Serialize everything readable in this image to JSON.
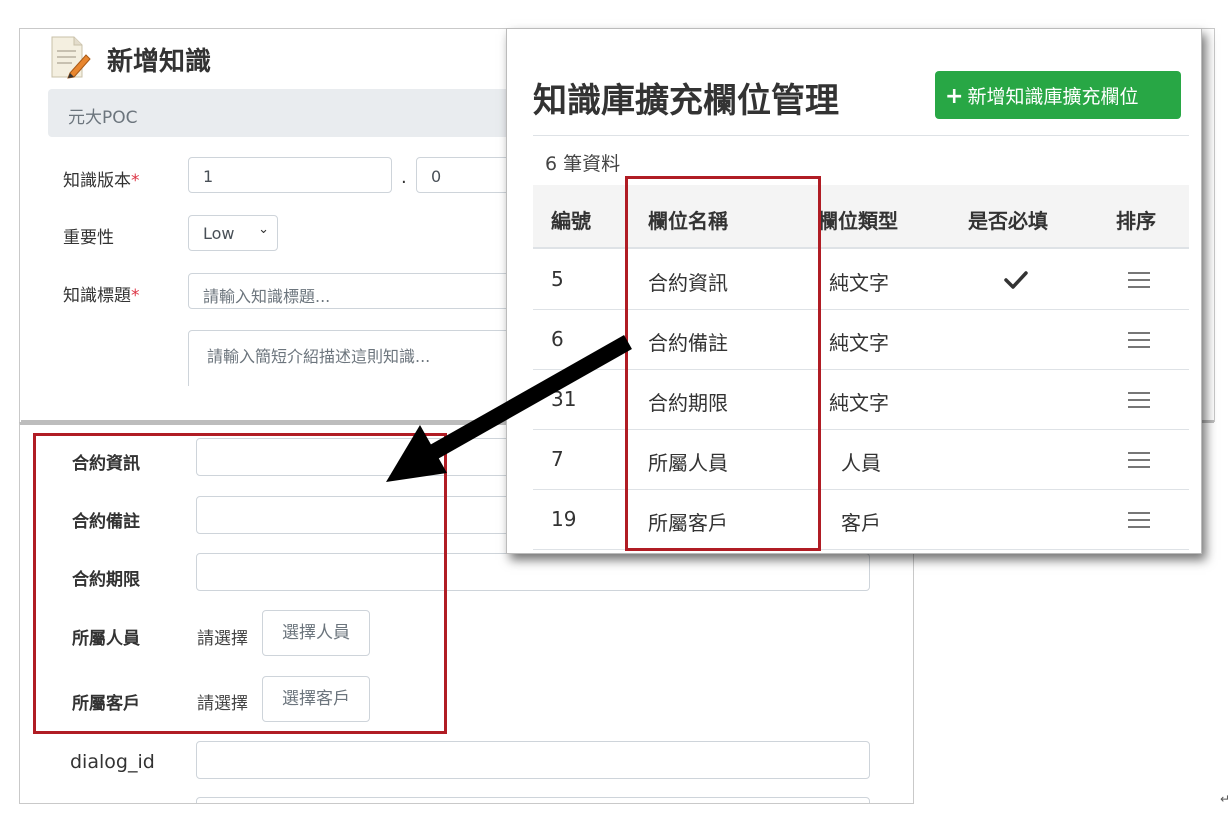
{
  "form": {
    "title": "新增知識",
    "project": "元大POC",
    "version_label": "知識版本",
    "version_major": "1",
    "version_sep": ".",
    "version_minor": "0",
    "importance_label": "重要性",
    "importance_value": "Low",
    "title_label": "知識標題",
    "title_placeholder": "請輸入知識標題...",
    "desc_placeholder": "請輸入簡短介紹描述這則知識...",
    "required_mark": "*"
  },
  "extended_form": {
    "fields": [
      {
        "label": "合約資訊"
      },
      {
        "label": "合約備註"
      },
      {
        "label": "合約期限"
      }
    ],
    "person": {
      "label": "所屬人員",
      "choose": "請選擇",
      "button": "選擇人員"
    },
    "customer": {
      "label": "所屬客戶",
      "choose": "請選擇",
      "button": "選擇客戶"
    },
    "dialog_label": "dialog_id"
  },
  "modal": {
    "title": "知識庫擴充欄位管理",
    "add_button": "新增知識庫擴充欄位",
    "count": "6 筆資料",
    "headers": [
      "編號",
      "欄位名稱",
      "欄位類型",
      "是否必填",
      "排序"
    ],
    "rows": [
      {
        "id": "5",
        "name": "合約資訊",
        "type": "純文字",
        "required": true
      },
      {
        "id": "6",
        "name": "合約備註",
        "type": "純文字",
        "required": false
      },
      {
        "id": "31",
        "name": "合約期限",
        "type": "純文字",
        "required": false
      },
      {
        "id": "7",
        "name": "所屬人員",
        "type": "人員",
        "required": false
      },
      {
        "id": "19",
        "name": "所屬客戶",
        "type": "客戶",
        "required": false
      }
    ]
  },
  "colors": {
    "accent_green": "#28a745",
    "highlight_red": "#b01c24",
    "required_red": "#dc3545"
  },
  "icons": [
    "document-edit-icon",
    "chevron-down-icon",
    "plus-icon",
    "checkmark-icon",
    "drag-handle-icon",
    "arrow-icon"
  ]
}
